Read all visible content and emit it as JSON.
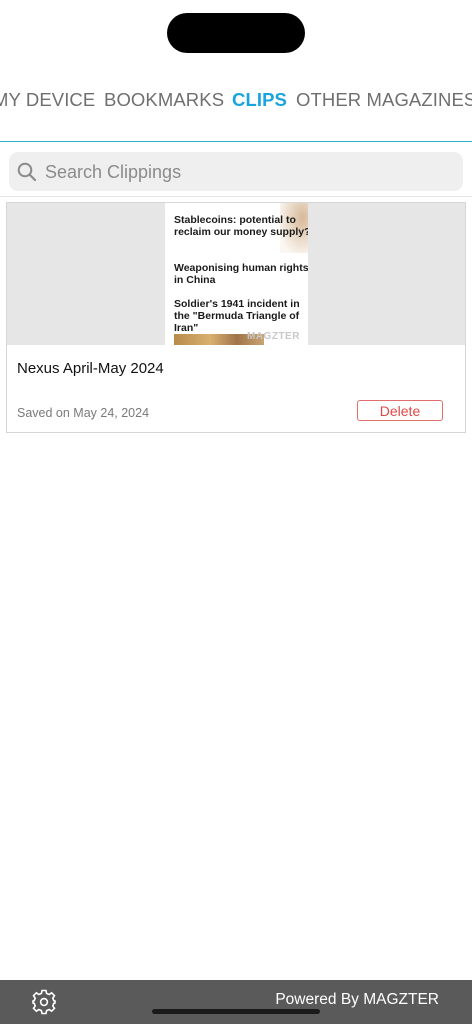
{
  "tabs": [
    {
      "label": "MY DEVICE"
    },
    {
      "label": "BOOKMARKS"
    },
    {
      "label": "CLIPS",
      "active": true
    },
    {
      "label": "OTHER MAGAZINES"
    }
  ],
  "search": {
    "placeholder": "Search Clippings",
    "value": "",
    "icon": "search-icon"
  },
  "clip": {
    "thumbnail": {
      "headlines": [
        "Stablecoins: potential to reclaim our money supply?",
        "Weaponising human rights in China",
        "Soldier's 1941 incident in the \"Bermuda Triangle of Iran\""
      ],
      "watermark": "MAGZTER"
    },
    "title": "Nexus April-May 2024",
    "date": "Saved on May 24, 2024",
    "delete_label": "Delete"
  },
  "footer": {
    "powered_by": "Powered By MAGZTER",
    "settings_icon": "gear-icon"
  },
  "colors": {
    "accent": "#1aa4de",
    "delete": "#e04848",
    "footer_bg": "#5a5a5a"
  }
}
